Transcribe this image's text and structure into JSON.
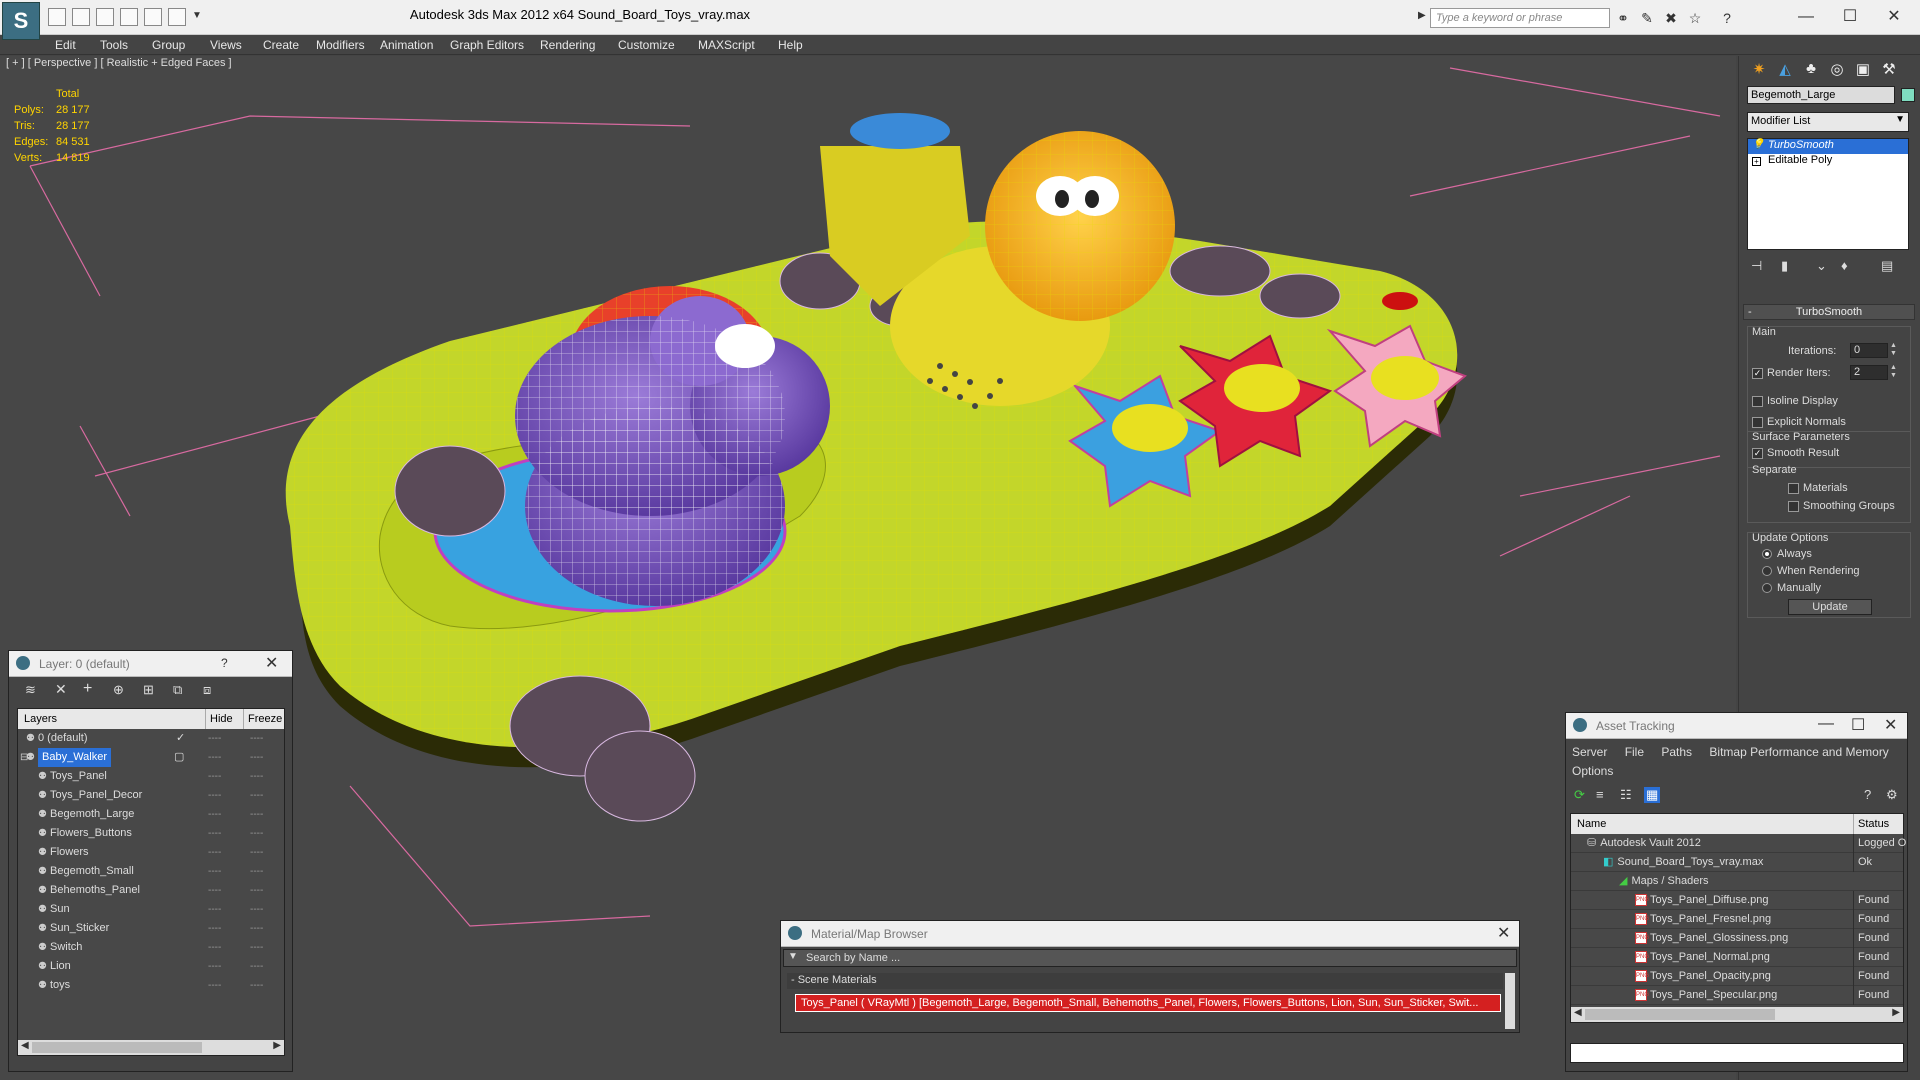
{
  "window": {
    "title": "Autodesk 3ds Max  2012 x64      Sound_Board_Toys_vray.max",
    "search_placeholder": "Type a keyword or phrase"
  },
  "menu": [
    "Edit",
    "Tools",
    "Group",
    "Views",
    "Create",
    "Modifiers",
    "Animation",
    "Graph Editors",
    "Rendering",
    "Customize",
    "MAXScript",
    "Help"
  ],
  "viewport": {
    "label": "[ + ] [ Perspective ] [ Realistic + Edged Faces ]",
    "stats_header": "Total",
    "stats": [
      {
        "label": "Polys:",
        "value": "28 177"
      },
      {
        "label": "Tris:",
        "value": "28 177"
      },
      {
        "label": "Edges:",
        "value": "84 531"
      },
      {
        "label": "Verts:",
        "value": "14 819"
      }
    ]
  },
  "command_panel": {
    "object_name": "Begemoth_Large",
    "modifier_list": "Modifier List",
    "stack": [
      "TurboSmooth",
      "Editable Poly"
    ],
    "rollout_title": "TurboSmooth",
    "main_group": "Main",
    "iterations_label": "Iterations:",
    "iterations_value": "0",
    "render_iters_label": "Render Iters:",
    "render_iters_value": "2",
    "isoline_label": "Isoline Display",
    "explicit_normals_label": "Explicit Normals",
    "surface_group": "Surface Parameters",
    "smooth_result_label": "Smooth Result",
    "separate_label": "Separate",
    "materials_label": "Materials",
    "smoothing_groups_label": "Smoothing Groups",
    "update_group": "Update Options",
    "always_label": "Always",
    "when_rendering_label": "When Rendering",
    "manually_label": "Manually",
    "update_button": "Update"
  },
  "layer_window": {
    "title": "Layer: 0 (default)",
    "help": "?",
    "col_layers": "Layers",
    "col_hide": "Hide",
    "col_freeze": "Freeze",
    "rows": [
      {
        "name": "0 (default)",
        "level": 0
      },
      {
        "name": "Baby_Walker",
        "level": 0
      },
      {
        "name": "Toys_Panel",
        "level": 1
      },
      {
        "name": "Toys_Panel_Decor",
        "level": 1
      },
      {
        "name": "Begemoth_Large",
        "level": 1
      },
      {
        "name": "Flowers_Buttons",
        "level": 1
      },
      {
        "name": "Flowers",
        "level": 1
      },
      {
        "name": "Begemoth_Small",
        "level": 1
      },
      {
        "name": "Behemoths_Panel",
        "level": 1
      },
      {
        "name": "Sun",
        "level": 1
      },
      {
        "name": "Sun_Sticker",
        "level": 1
      },
      {
        "name": "Switch",
        "level": 1
      },
      {
        "name": "Lion",
        "level": 1
      },
      {
        "name": "toys",
        "level": 1
      }
    ],
    "dash": "----"
  },
  "material_browser": {
    "title": "Material/Map Browser",
    "search_placeholder": "Search by Name ...",
    "section": "- Scene Materials",
    "entry": "Toys_Panel  ( VRayMtl )  [Begemoth_Large, Begemoth_Small, Behemoths_Panel, Flowers, Flowers_Buttons, Lion, Sun, Sun_Sticker, Swit..."
  },
  "asset_tracking": {
    "title": "Asset Tracking",
    "menu": [
      "Server",
      "File",
      "Paths",
      "Bitmap Performance and Memory",
      "Options"
    ],
    "col_name": "Name",
    "col_status": "Status",
    "rows": [
      {
        "name": "Autodesk Vault 2012",
        "status": "Logged O",
        "indent": 1
      },
      {
        "name": "Sound_Board_Toys_vray.max",
        "status": "Ok",
        "indent": 2
      },
      {
        "name": "Maps / Shaders",
        "status": "",
        "indent": 3
      },
      {
        "name": "Toys_Panel_Diffuse.png",
        "status": "Found",
        "indent": 4
      },
      {
        "name": "Toys_Panel_Fresnel.png",
        "status": "Found",
        "indent": 4
      },
      {
        "name": "Toys_Panel_Glossiness.png",
        "status": "Found",
        "indent": 4
      },
      {
        "name": "Toys_Panel_Normal.png",
        "status": "Found",
        "indent": 4
      },
      {
        "name": "Toys_Panel_Opacity.png",
        "status": "Found",
        "indent": 4
      },
      {
        "name": "Toys_Panel_Specular.png",
        "status": "Found",
        "indent": 4
      }
    ]
  },
  "colors": {
    "selection": "#2a6fd6",
    "panel_yellow": "#c3d62a",
    "wire": "#e8e000",
    "stats_text": "#ffd400",
    "grid_pink": "#d86aa0"
  }
}
